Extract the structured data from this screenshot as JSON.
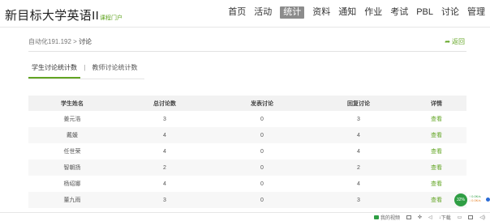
{
  "header": {
    "title": "新目标大学英语II",
    "subtitle": "课程门户",
    "nav": [
      {
        "label": "首页",
        "active": false
      },
      {
        "label": "活动",
        "active": false
      },
      {
        "label": "统计",
        "active": true
      },
      {
        "label": "资料",
        "active": false
      },
      {
        "label": "通知",
        "active": false
      },
      {
        "label": "作业",
        "active": false
      },
      {
        "label": "考试",
        "active": false
      },
      {
        "label": "PBL",
        "active": false
      },
      {
        "label": "讨论",
        "active": false
      },
      {
        "label": "管理",
        "active": false
      }
    ]
  },
  "breadcrumb": {
    "parent": "自动化191.192",
    "separator": ">",
    "current": "讨论",
    "back_label": "返回",
    "back_icon": "back-arrow-icon"
  },
  "tabs": {
    "active": "学生讨论统计数",
    "separator": "|",
    "other": "教师讨论统计数"
  },
  "table": {
    "columns": [
      "学生姓名",
      "总讨论数",
      "发表讨论",
      "回复讨论",
      "详情"
    ],
    "rows": [
      {
        "name": "姜元浩",
        "total": "3",
        "posted": "0",
        "replied": "3",
        "detail": "查看"
      },
      {
        "name": "戴媛",
        "total": "4",
        "posted": "0",
        "replied": "4",
        "detail": "查看"
      },
      {
        "name": "任世荣",
        "total": "4",
        "posted": "0",
        "replied": "4",
        "detail": "查看"
      },
      {
        "name": "智朝扬",
        "total": "2",
        "posted": "0",
        "replied": "2",
        "detail": "查看"
      },
      {
        "name": "杨绍娜",
        "total": "4",
        "posted": "0",
        "replied": "4",
        "detail": "查看"
      },
      {
        "name": "董九雨",
        "total": "3",
        "posted": "0",
        "replied": "3",
        "detail": "查看"
      }
    ]
  },
  "widget": {
    "percent": "32%",
    "up": "↑ 0.0K/s",
    "down": "↓ 0.0K/s"
  },
  "statusbar": {
    "video_label": "我的视频",
    "download_label": "下载"
  },
  "colors": {
    "accent": "#62a523",
    "nav_active_bg": "#8c8c8c"
  }
}
